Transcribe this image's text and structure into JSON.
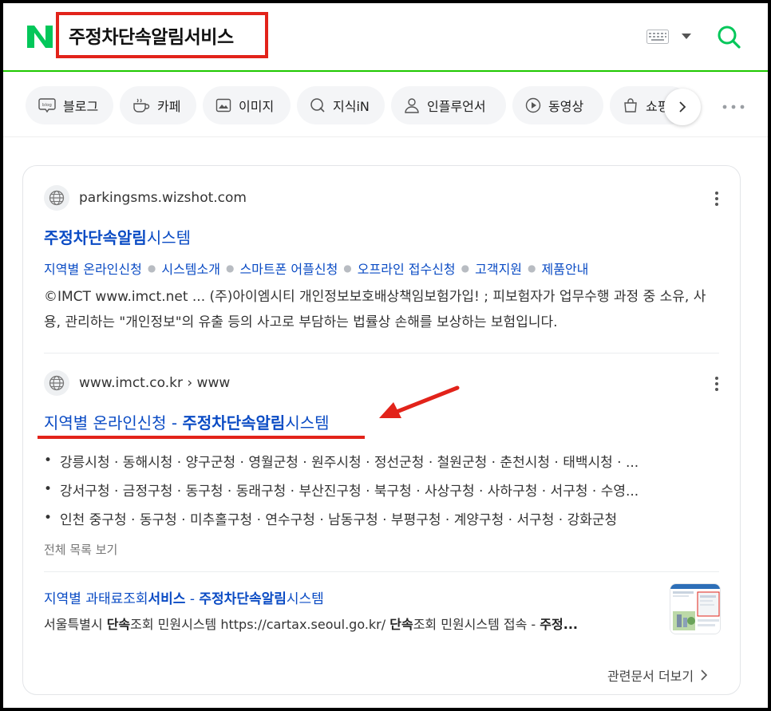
{
  "header": {
    "query": "주정차단속알림서비스"
  },
  "tabs": [
    {
      "label": "블로그"
    },
    {
      "label": "카페"
    },
    {
      "label": "이미지"
    },
    {
      "label": "지식iN"
    },
    {
      "label": "인플루언서"
    },
    {
      "label": "동영상"
    },
    {
      "label": "쇼핑"
    }
  ],
  "result1": {
    "url": "parkingsms.wizshot.com",
    "title_bold": "주정차단속알림",
    "title_rest": "시스템",
    "sitelinks": [
      "지역별 온라인신청",
      "시스템소개",
      "스마트폰 어플신청",
      "오프라인 접수신청",
      "고객지원",
      "제품안내"
    ],
    "description": "©IMCT www.imct.net ... (주)아이엠시티 개인정보보호배상책임보험가입! ; 피보험자가 업무수행 과정 중 소유, 사용, 관리하는 \"개인정보\"의 유출 등의 사고로 부담하는 법률상 손해를 보상하는 보험입니다."
  },
  "result2": {
    "url": "www.imct.co.kr › www",
    "title_prefix": "지역별 온라인신청 - ",
    "title_bold": "주정차단속알림",
    "title_rest": "시스템",
    "bullets": [
      "강릉시청 · 동해시청 · 양구군청 · 영월군청 · 원주시청 · 정선군청 · 철원군청 · 춘천시청 · 태백시청 · ...",
      "강서구청 · 금정구청 · 동구청 · 동래구청 · 부산진구청 · 북구청 · 사상구청 · 사하구청 · 서구청 · 수영...",
      "인천 중구청 · 동구청 · 미추홀구청 · 연수구청 · 남동구청 · 부평구청 · 계양구청 · 서구청 · 강화군청"
    ],
    "view_all": "전체 목록 보기",
    "sub_result": {
      "title_prefix": "지역별 과태료조회",
      "title_bold1": "서비스",
      "title_mid": " - ",
      "title_bold2": "주정차단속알림",
      "title_rest": "시스템",
      "desc_p1": "서울특별시 ",
      "desc_b1": "단속",
      "desc_p2": "조회 민원시스템 https://cartax.seoul.go.kr/ ",
      "desc_b2": "단속",
      "desc_p3": "조회 민원시스템 접속 - ",
      "desc_b3": "주정..."
    }
  },
  "footer": {
    "more_docs": "관련문서 더보기"
  },
  "colors": {
    "naver_green": "#03c75a",
    "link_blue": "#0a4bc4",
    "annotation_red": "#e2231a"
  }
}
